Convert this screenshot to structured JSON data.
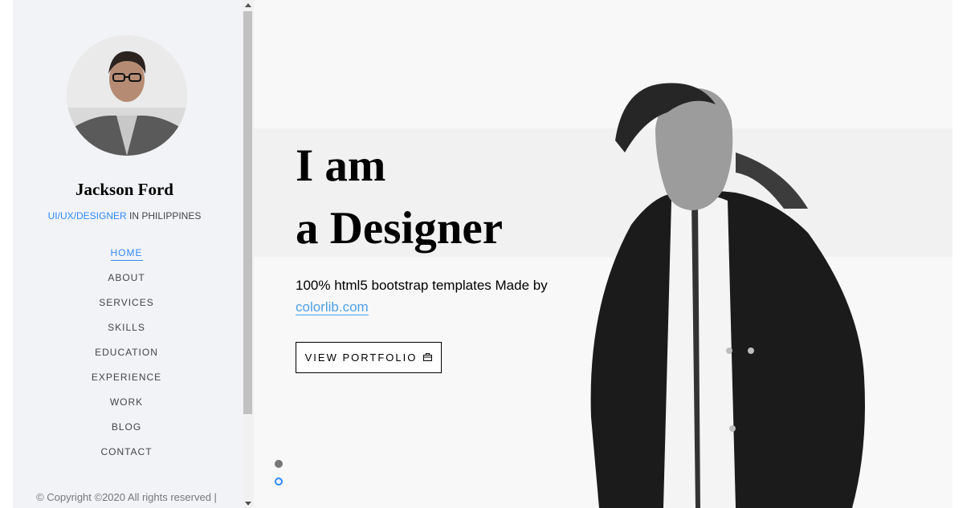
{
  "profile": {
    "name": "Jackson Ford",
    "role": "UI/UX/DESIGNER",
    "location": " IN PHILIPPINES"
  },
  "nav": {
    "items": [
      {
        "label": "HOME",
        "active": true
      },
      {
        "label": "ABOUT"
      },
      {
        "label": "SERVICES"
      },
      {
        "label": "SKILLS"
      },
      {
        "label": "EDUCATION"
      },
      {
        "label": "EXPERIENCE"
      },
      {
        "label": "WORK"
      },
      {
        "label": "BLOG"
      },
      {
        "label": "CONTACT"
      }
    ]
  },
  "footer": {
    "copyright": "© Copyright ©2020 All rights reserved |"
  },
  "hero": {
    "line1": "I am",
    "line2": "a Designer",
    "subtitle": "100% html5 bootstrap templates Made by ",
    "link_text": "colorlib.com",
    "button_label": "VIEW PORTFOLIO",
    "button_icon": "briefcase-icon"
  },
  "colors": {
    "accent": "#2f89fc",
    "sidebar_bg": "#f2f3f7"
  }
}
